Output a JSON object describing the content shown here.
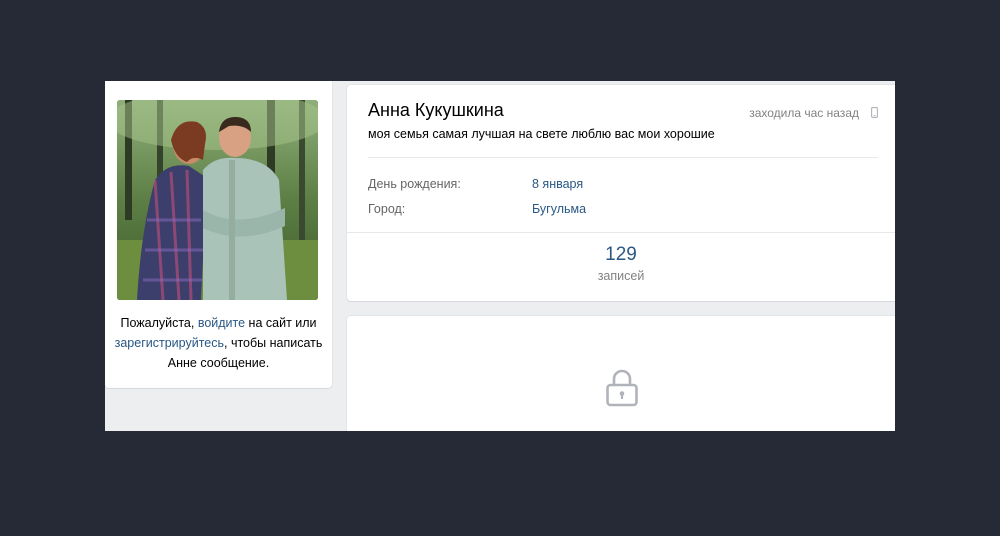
{
  "profile": {
    "name": "Анна Кукушкина",
    "status": "моя семья самая лучшая на свете люблю вас мои хорошие",
    "last_seen": "заходила час назад",
    "last_seen_device_icon": "mobile-phone-icon",
    "info": [
      {
        "label": "День рождения:",
        "value": "8 января"
      },
      {
        "label": "Город:",
        "value": "Бугульма"
      }
    ],
    "counters": [
      {
        "count": "129",
        "label": "записей"
      }
    ]
  },
  "sidebar": {
    "photo_alt": "profile photo",
    "login_prompt": {
      "text_before": "Пожалуйста, ",
      "login_link": "войдите",
      "text_middle": " на сайт или ",
      "register_link": "зарегистрируйтесь",
      "text_after": ", чтобы написать Анне сообщение."
    }
  },
  "private_block": {
    "icon": "lock-icon"
  },
  "colors": {
    "page_background": "#262a36",
    "frame_background": "#edeef0",
    "link": "#2a5885",
    "muted": "#828282"
  }
}
